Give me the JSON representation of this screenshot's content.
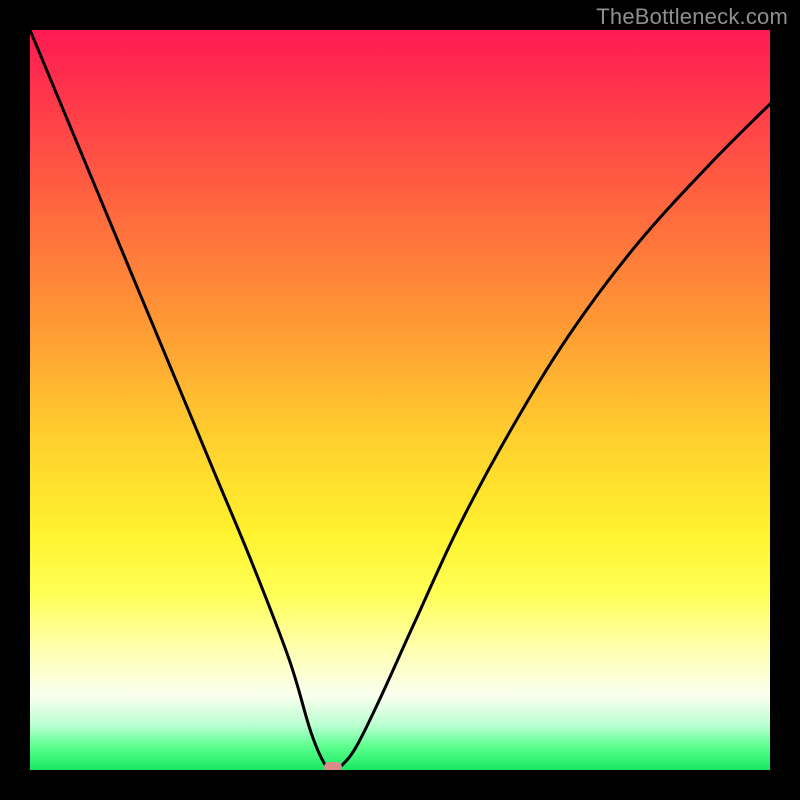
{
  "watermark": "TheBottleneck.com",
  "chart_data": {
    "type": "line",
    "title": "",
    "xlabel": "",
    "ylabel": "",
    "xlim": [
      0,
      100
    ],
    "ylim": [
      0,
      100
    ],
    "background_gradient": {
      "top": "#ff1a52",
      "middle": "#ffff55",
      "bottom": "#17e863"
    },
    "series": [
      {
        "name": "bottleneck-curve",
        "color": "#000000",
        "x": [
          0,
          5,
          10,
          15,
          20,
          25,
          30,
          35,
          38,
          40,
          41,
          42,
          44,
          47,
          52,
          58,
          65,
          73,
          82,
          92,
          100
        ],
        "values": [
          100,
          88,
          76,
          64,
          52,
          40,
          28,
          15,
          5,
          0.5,
          0,
          0.5,
          3,
          9,
          20,
          33,
          46,
          59,
          71,
          82,
          90
        ]
      }
    ],
    "marker": {
      "x": 41,
      "y": 0,
      "color": "#d98c8a",
      "shape": "pill"
    },
    "note": "x and values are in percent of the plot area; values measured from bottom (0 = bottom / green, 100 = top / red)"
  }
}
